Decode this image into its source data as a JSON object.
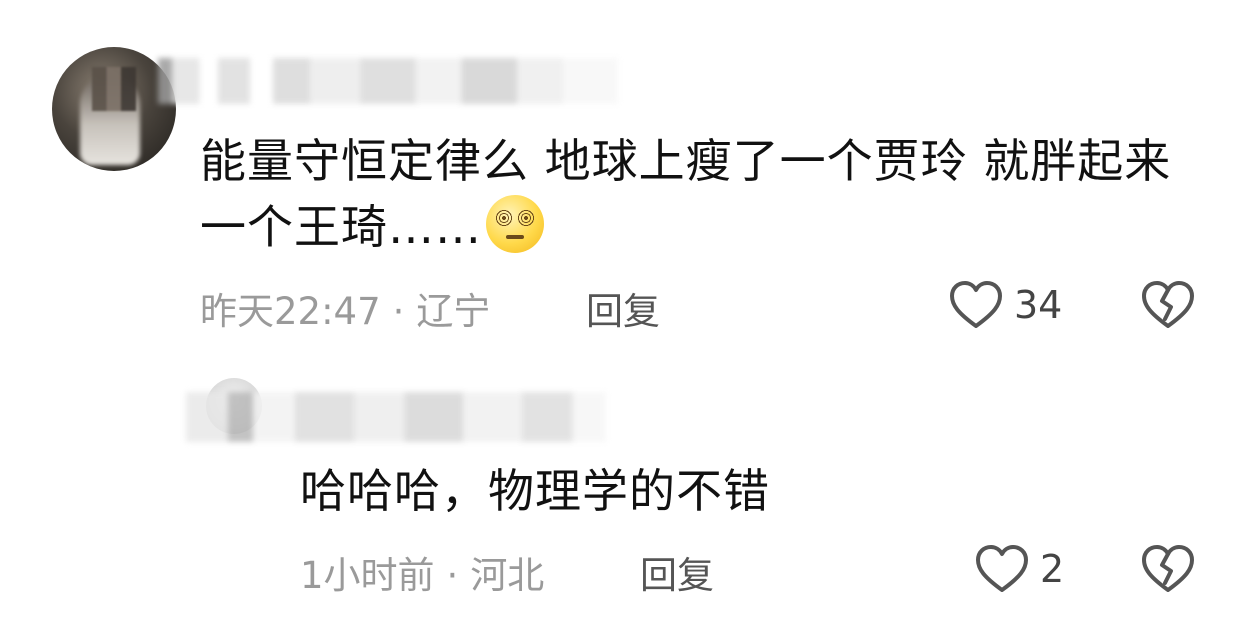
{
  "comments": [
    {
      "text": "能量守恒定律么 地球上瘦了一个贾玲 就胖起来一个王琦……",
      "emoji": "dizzy-face",
      "time": "昨天22:47",
      "location": "辽宁",
      "reply_label": "回复",
      "likes": "34"
    },
    {
      "text": "哈哈哈，物理学的不错",
      "time": "1小时前",
      "location": "河北",
      "reply_label": "回复",
      "likes": "2"
    }
  ],
  "separator": "·",
  "icons": {
    "like": "heart-outline-icon",
    "dislike": "broken-heart-icon",
    "icon_color": "#555555"
  }
}
